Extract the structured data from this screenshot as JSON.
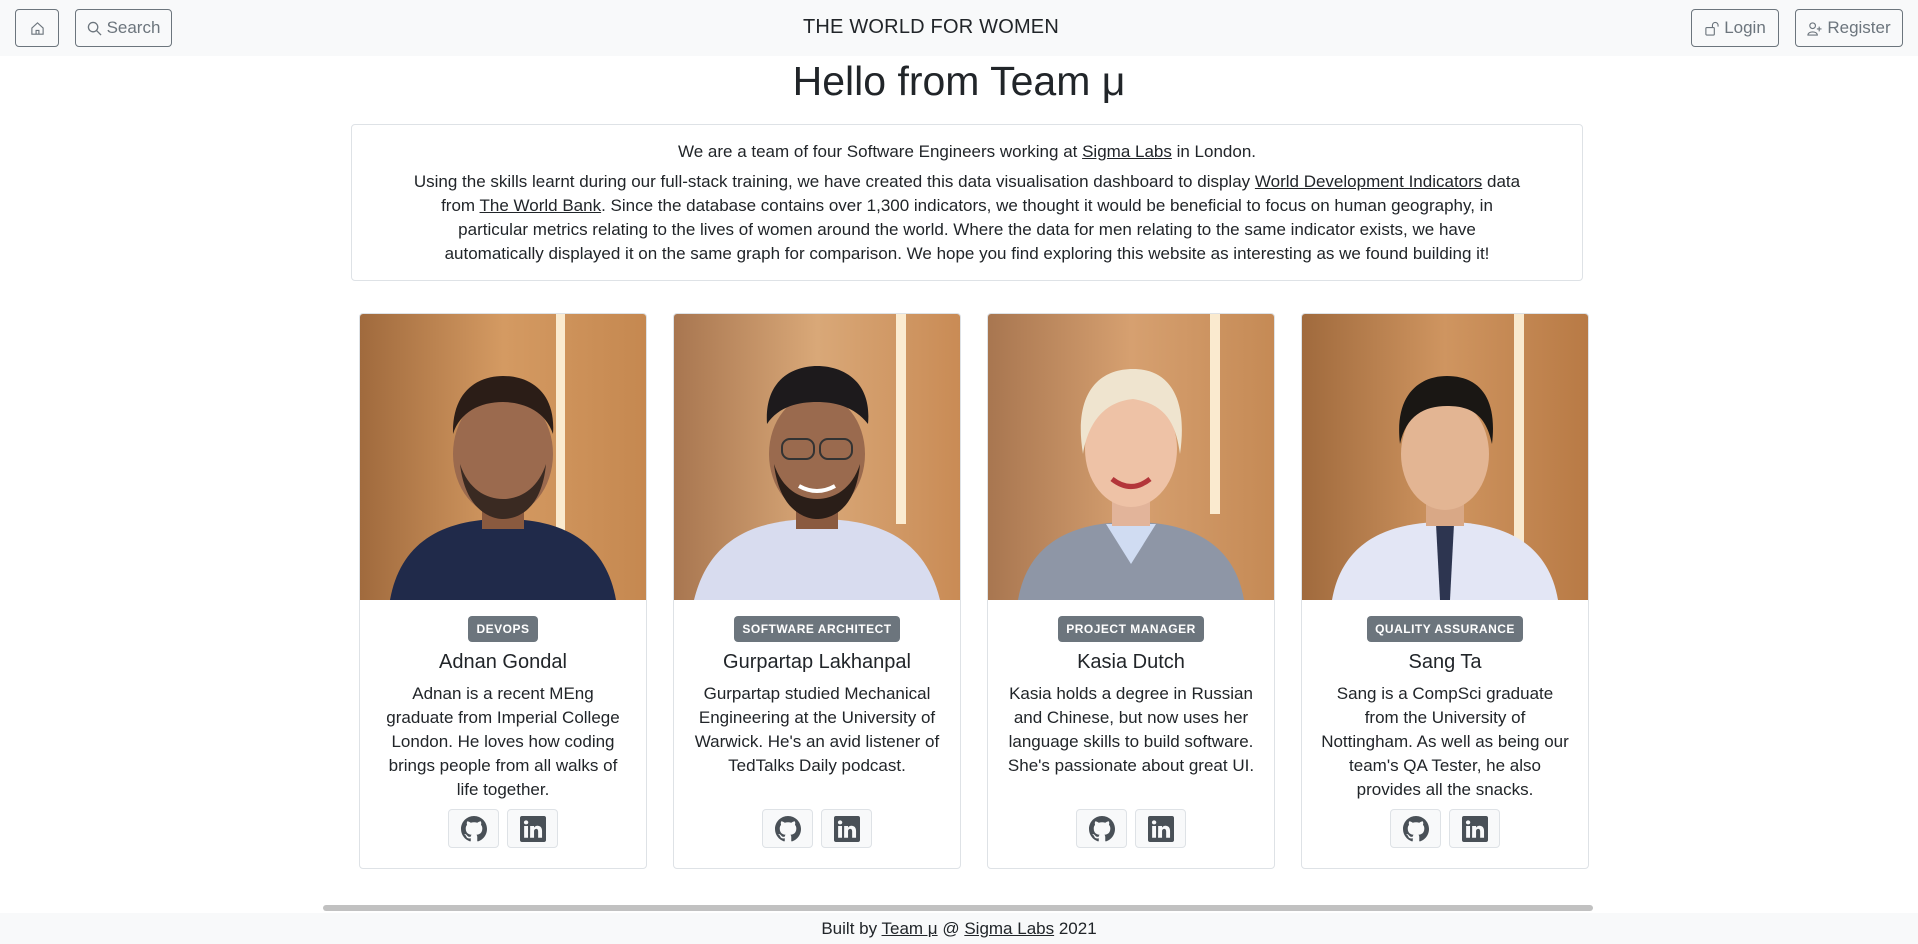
{
  "navbar": {
    "home_icon": "home-icon",
    "search_label": "Search",
    "brand": "THE WORLD FOR WOMEN",
    "login_label": "Login",
    "register_label": "Register"
  },
  "main": {
    "title": "Hello from Team μ",
    "intro": {
      "lead_prefix": "We are a team of four Software Engineers working at ",
      "lead_link": "Sigma Labs",
      "lead_suffix": " in London.",
      "body_1": "Using the skills learnt during our full-stack training, we have created this data visualisation dashboard to display ",
      "link_wdi": "World Development Indicators",
      "body_2": " data from ",
      "link_wb": "The World Bank",
      "body_3": ". Since the database contains over 1,300 indicators, we thought it would be beneficial to focus on human geography, in particular metrics relating to the lives of women around the world. Where the data for men relating to the same indicator exists, we have automatically displayed it on the same graph for comparison. We hope you find exploring this website as interesting as we found building it!"
    }
  },
  "team": [
    {
      "role": "DEVOPS",
      "name": "Adnan Gondal",
      "bio": "Adnan is a recent MEng graduate from Imperial College London. He loves how coding brings people from all walks of life together."
    },
    {
      "role": "SOFTWARE ARCHITECT",
      "name": "Gurpartap Lakhanpal",
      "bio": "Gurpartap studied Mechanical Engineering at the University of Warwick. He's an avid listener of TedTalks Daily podcast."
    },
    {
      "role": "PROJECT MANAGER",
      "name": "Kasia Dutch",
      "bio": "Kasia holds a degree in Russian and Chinese, but now uses her language skills to build software. She's passionate about great UI."
    },
    {
      "role": "QUALITY ASSURANCE",
      "name": "Sang Ta",
      "bio": "Sang is a CompSci graduate from the University of Nottingham. As well as being our team's QA Tester, he also provides all the snacks."
    }
  ],
  "footer": {
    "prefix": "Built by ",
    "team_link": "Team μ",
    "mid": " @ ",
    "org_link": "Sigma Labs",
    "suffix": " 2021"
  },
  "colors": {
    "navbar_bg": "#f8f9fa",
    "badge_bg": "#6c757d",
    "border": "#dee2e6"
  }
}
